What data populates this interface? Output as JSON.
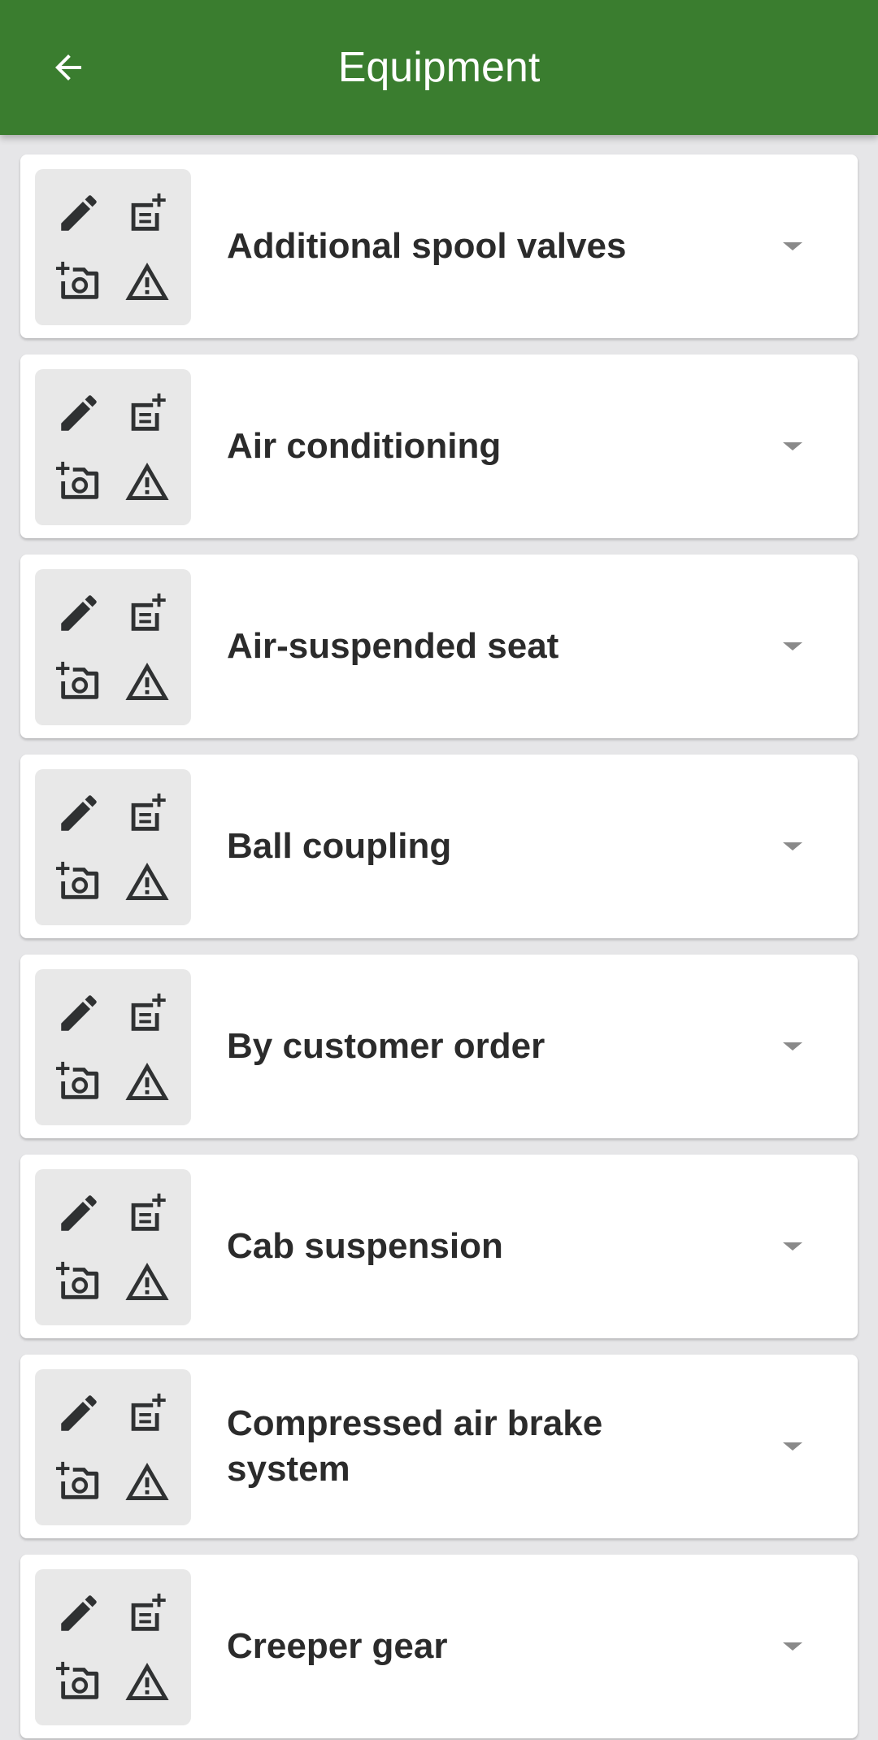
{
  "app_bar": {
    "title": "Equipment",
    "back_icon": "arrow-back-icon",
    "color": "#3a7d2f"
  },
  "card_actions": {
    "icons": [
      "pencil-icon",
      "note-add-icon",
      "add-photo-icon",
      "warning-icon"
    ]
  },
  "items": [
    {
      "label": "Additional spool valves"
    },
    {
      "label": "Air conditioning"
    },
    {
      "label": "Air-suspended seat"
    },
    {
      "label": "Ball coupling"
    },
    {
      "label": "By customer order"
    },
    {
      "label": "Cab suspension"
    },
    {
      "label": "Compressed air brake system"
    },
    {
      "label": "Creeper gear"
    }
  ]
}
